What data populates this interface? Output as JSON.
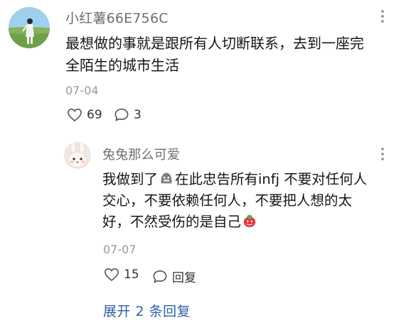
{
  "comment": {
    "username": "小红薯66E756C",
    "content": "最想做的事就是跟所有人切断联系，去到一座完\n全陌生的城市生活",
    "date": "07-04",
    "likes": "69",
    "replies": "3",
    "avatar_icon": "avatar-photo",
    "more_icon": "more-icon"
  },
  "reply": {
    "username": "兔兔那么可爱",
    "content_part1": "我做到了",
    "content_part2": "在此忠告所有infj 不要对任何人",
    "content_line2": "交心，不要依赖任何人，不要把人想的太",
    "content_line3": "好，不然受伤的是自己",
    "date": "07-07",
    "likes": "15",
    "reply_label": "回复",
    "emoji_1": "grimace-emoji",
    "emoji_2": "red-face-emoji"
  },
  "expand_label": "展开 2 条回复"
}
